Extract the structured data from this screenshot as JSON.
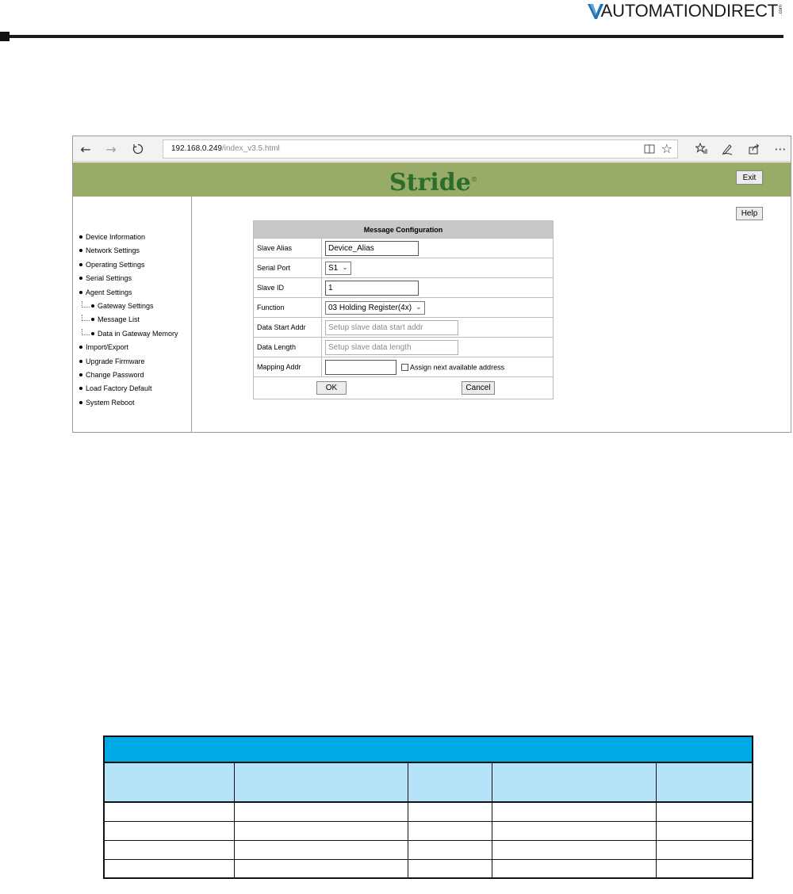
{
  "brand": {
    "text": "AUTOMATIONDIRECT",
    "suffix": ".com"
  },
  "browser": {
    "address_host": "192.168.0.249",
    "address_path": "/index_v3.5.html"
  },
  "app": {
    "logo": "Stride",
    "exit_label": "Exit",
    "help_label": "Help",
    "header_color": "#98ac68"
  },
  "sidebar": {
    "items": [
      {
        "label": "Device Information",
        "level": 0
      },
      {
        "label": "Network Settings",
        "level": 0
      },
      {
        "label": "Operating Settings",
        "level": 0
      },
      {
        "label": "Serial Settings",
        "level": 0
      },
      {
        "label": "Agent Settings",
        "level": 0
      },
      {
        "label": "Gateway Settings",
        "level": 1
      },
      {
        "label": "Message List",
        "level": 1
      },
      {
        "label": "Data in Gateway Memory",
        "level": 1
      },
      {
        "label": "Import/Export",
        "level": 0
      },
      {
        "label": "Upgrade Firmware",
        "level": 0
      },
      {
        "label": "Change Password",
        "level": 0
      },
      {
        "label": "Load Factory Default",
        "level": 0
      },
      {
        "label": "System Reboot",
        "level": 0
      }
    ]
  },
  "message_config": {
    "title": "Message Configuration",
    "slave_alias": {
      "label": "Slave Alias",
      "value": "Device_Alias"
    },
    "serial_port": {
      "label": "Serial Port",
      "value": "S1"
    },
    "slave_id": {
      "label": "Slave ID",
      "value": "1"
    },
    "function": {
      "label": "Function",
      "value": "03 Holding Register(4x)"
    },
    "data_start": {
      "label": "Data Start Addr",
      "placeholder": "Setup slave data start addr"
    },
    "data_length": {
      "label": "Data Length",
      "placeholder": "Setup slave data length"
    },
    "mapping_addr": {
      "label": "Mapping Addr",
      "value": "",
      "checkbox_label": "Assign next available address"
    },
    "ok_label": "OK",
    "cancel_label": "Cancel"
  },
  "bottom_table": {
    "title_color": "#00a9e6",
    "header_color": "#b5e3f8",
    "rows": 4,
    "columns": 5
  }
}
